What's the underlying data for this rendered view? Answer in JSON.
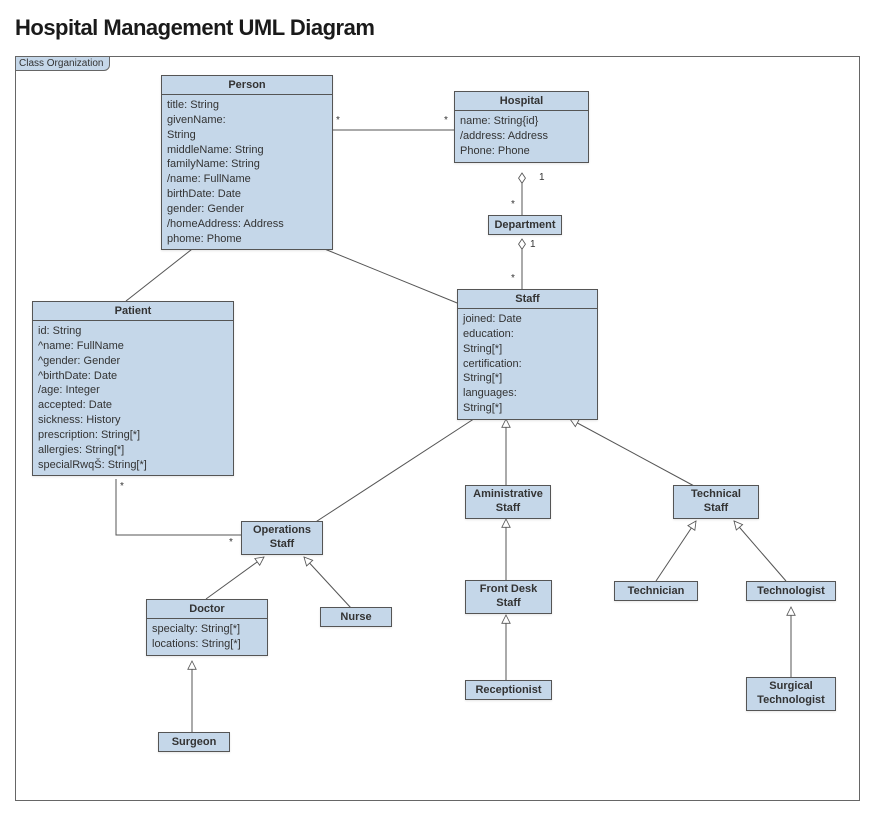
{
  "title": "Hospital Management UML Diagram",
  "frameLabel": "Class Organization",
  "classes": {
    "person": {
      "name": "Person",
      "attrs": "title: String\ngivenName:\nString\nmiddleName: String\nfamilyName: String\n/name: FullName\nbirthDate: Date\ngender: Gender\n/homeAddress: Address\nphome: Phome"
    },
    "hospital": {
      "name": "Hospital",
      "attrs": "name: String{id}\n/address: Address\nPhone: Phone"
    },
    "department": {
      "name": "Department"
    },
    "patient": {
      "name": "Patient",
      "attrs": "id: String\n^name: FullName\n^gender: Gender\n^birthDate: Date\n/age: Integer\naccepted: Date\nsickness: History\nprescription: String[*]\nallergies: String[*]\nspecialRwqŠ: String[*]"
    },
    "staff": {
      "name": "Staff",
      "attrs": "joined: Date\neducation:\nString[*]\ncertification:\nString[*]\nlanguages:\nString[*]"
    },
    "opsStaff": {
      "name": "Operations\nStaff"
    },
    "adminStaff": {
      "name": "Aministrative\nStaff"
    },
    "techStaff": {
      "name": "Technical\nStaff"
    },
    "doctor": {
      "name": "Doctor",
      "attrs": "specialty: String[*]\nlocations: String[*]"
    },
    "nurse": {
      "name": "Nurse"
    },
    "frontDesk": {
      "name": "Front Desk\nStaff"
    },
    "technician": {
      "name": "Technician"
    },
    "technologist": {
      "name": "Technologist"
    },
    "surgeon": {
      "name": "Surgeon"
    },
    "receptionist": {
      "name": "Receptionist"
    },
    "surgTech": {
      "name": "Surgical\nTechnologist"
    }
  },
  "multiplicities": {
    "personHospL": "*",
    "personHospR": "*",
    "hospDept1": "1",
    "hospDeptStar": "*",
    "deptStaff1": "1",
    "deptStaffStar": "*",
    "patientStar": "*",
    "opsStar": "*"
  }
}
